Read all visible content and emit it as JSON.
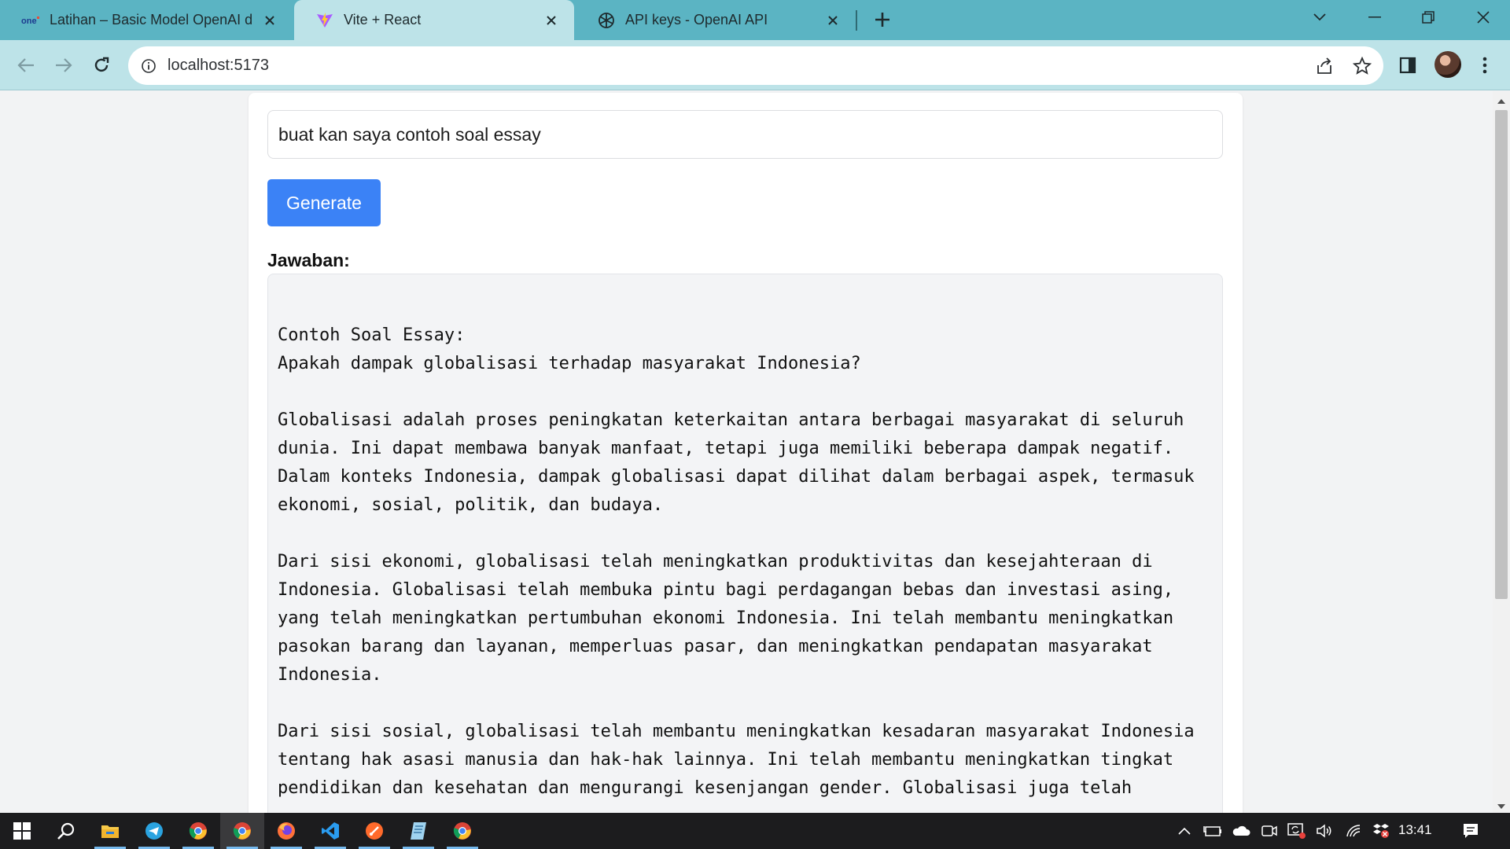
{
  "browser": {
    "tabs": [
      {
        "title": "Latihan – Basic Model OpenAI d",
        "favicon": "onecode-favicon"
      },
      {
        "title": "Vite + React",
        "favicon": "vite-favicon",
        "active": true
      },
      {
        "title": "API keys - OpenAI API",
        "favicon": "openai-favicon"
      }
    ],
    "url": "localhost:5173"
  },
  "page": {
    "prompt_value": "buat kan saya contoh soal essay",
    "generate_label": "Generate",
    "answer_label": "Jawaban:",
    "answer_text": "Contoh Soal Essay:\nApakah dampak globalisasi terhadap masyarakat Indonesia?\n\nGlobalisasi adalah proses peningkatan keterkaitan antara berbagai masyarakat di seluruh\ndunia. Ini dapat membawa banyak manfaat, tetapi juga memiliki beberapa dampak negatif.\nDalam konteks Indonesia, dampak globalisasi dapat dilihat dalam berbagai aspek, termasuk\nekonomi, sosial, politik, dan budaya.\n\nDari sisi ekonomi, globalisasi telah meningkatkan produktivitas dan kesejahteraan di\nIndonesia. Globalisasi telah membuka pintu bagi perdagangan bebas dan investasi asing,\nyang telah meningkatkan pertumbuhan ekonomi Indonesia. Ini telah membantu meningkatkan\npasokan barang dan layanan, memperluas pasar, dan meningkatkan pendapatan masyarakat\nIndonesia.\n\nDari sisi sosial, globalisasi telah membantu meningkatkan kesadaran masyarakat Indonesia\ntentang hak asasi manusia dan hak-hak lainnya. Ini telah membantu meningkatkan tingkat\npendidikan dan kesehatan dan mengurangi kesenjangan gender. Globalisasi juga telah"
  },
  "taskbar": {
    "clock": "13:41",
    "apps": [
      "start-icon",
      "search-icon",
      "file-explorer-icon",
      "telegram-icon",
      "chrome-icon",
      "chrome-icon",
      "firefox-icon",
      "vscode-icon",
      "git-icon",
      "notepad-icon",
      "chrome-icon"
    ]
  },
  "colors": {
    "tabstrip": "#5bb4c3",
    "toolbar": "#bde3e8",
    "accent_button": "#3b82f6",
    "answer_bg": "#f3f4f6"
  }
}
